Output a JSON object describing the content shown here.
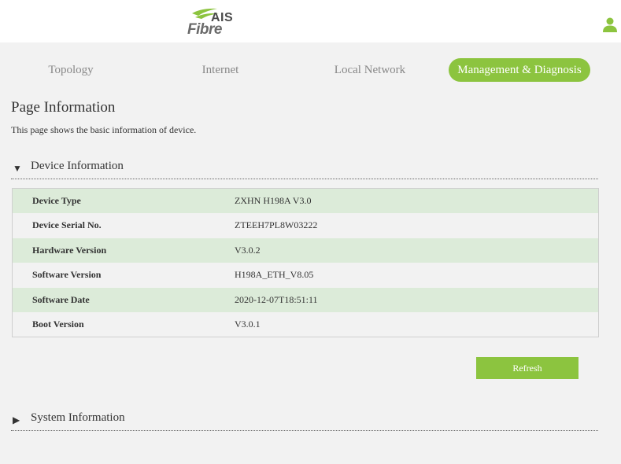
{
  "brand": {
    "top": "AIS",
    "bottom": "Fibre"
  },
  "nav": {
    "tabs": [
      {
        "label": "Topology",
        "active": false
      },
      {
        "label": "Internet",
        "active": false
      },
      {
        "label": "Local Network",
        "active": false
      },
      {
        "label": "Management & Diagnosis",
        "active": true
      }
    ]
  },
  "page": {
    "title": "Page Information",
    "description": "This page shows the basic information of device."
  },
  "device_section": {
    "title": "Device Information",
    "expanded": true,
    "rows": [
      {
        "key": "Device Type",
        "value": "ZXHN H198A V3.0"
      },
      {
        "key": "Device Serial No.",
        "value": "ZTEEH7PL8W03222"
      },
      {
        "key": "Hardware Version",
        "value": "V3.0.2"
      },
      {
        "key": "Software Version",
        "value": "H198A_ETH_V8.05"
      },
      {
        "key": "Software Date",
        "value": "2020-12-07T18:51:11"
      },
      {
        "key": "Boot Version",
        "value": "V3.0.1"
      }
    ]
  },
  "refresh_label": "Refresh",
  "system_section": {
    "title": "System Information",
    "expanded": false
  },
  "icons": {
    "user": "user-icon",
    "expanded_arrow": "triangle-down-icon",
    "collapsed_arrow": "triangle-right-icon"
  },
  "colors": {
    "accent": "#8cc43f",
    "row_alt": "#dcebd9",
    "background": "#f2f2f2"
  }
}
